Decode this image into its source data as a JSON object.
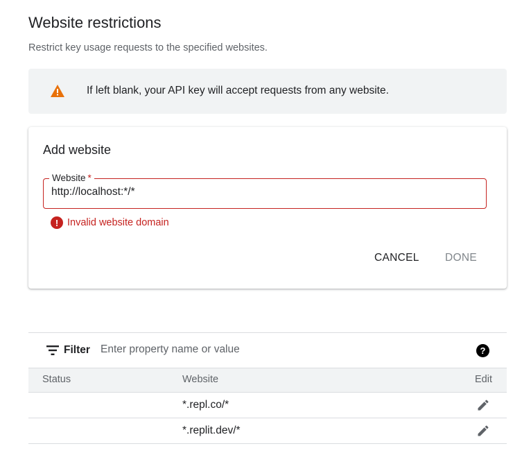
{
  "header": {
    "title": "Website restrictions",
    "subtitle": "Restrict key usage requests to the specified websites."
  },
  "banner": {
    "icon": "warning-icon",
    "icon_color": "#e8710a",
    "text": "If left blank, your API key will accept requests from any website."
  },
  "add_website": {
    "title": "Add website",
    "field_label": "Website",
    "required_mark": "*",
    "value": "http://localhost:*/*",
    "error_icon": "error-icon",
    "error_text": "Invalid website domain",
    "error_color": "#c5221f",
    "cancel_label": "CANCEL",
    "done_label": "DONE"
  },
  "filter": {
    "icon": "filter-icon",
    "label": "Filter",
    "placeholder": "Enter property name or value",
    "help_icon": "help-icon"
  },
  "table": {
    "columns": [
      "Status",
      "Website",
      "Edit"
    ],
    "rows": [
      {
        "status": "",
        "website": "*.repl.co/*",
        "edit_icon": "pencil-icon"
      },
      {
        "status": "",
        "website": "*.replit.dev/*",
        "edit_icon": "pencil-icon"
      }
    ]
  }
}
